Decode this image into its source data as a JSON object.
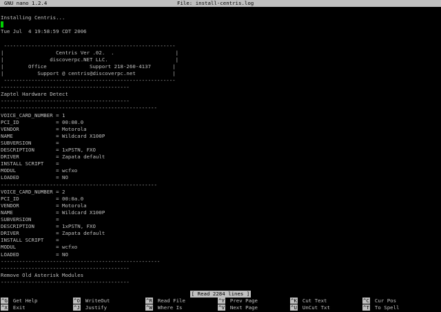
{
  "titlebar": {
    "version": "GNU nano 1.2.4",
    "file": "File: install-centris.log"
  },
  "editor": {
    "lines": [
      "",
      "Installing Centris...",
      "",
      "Tue Jul  4 19:58:59 CDT 2006",
      "",
      " --------------------------------------------------------",
      "|                 Centris Ver .02.  .                    |",
      "|               discoverpc.NET LLC.                      |",
      "|        Office              Support 218-260-4137       |",
      "|           Support @ centris@discoverpc.net            |",
      " --------------------------------------------------------",
      "------------------------------------------",
      "Zaptel Hardware Detect",
      "------------------------------------------",
      "---------------------------------------------------",
      "VOICE_CARD_NUMBER = 1",
      "PCI_ID            = 00:08.0",
      "VENDOR            = Motorola",
      "NAME              = Wildcard X100P",
      "SUBVERSION        =",
      "DESCRIPTION       = 1xPSTN, FXO",
      "DRIVER            = Zapata default",
      "INSTALL SCRIPT    =",
      "MODUL             = wcfxo",
      "LOADED            = NO",
      "---------------------------------------------------",
      "VOICE_CARD_NUMBER = 2",
      "PCI_ID            = 00:0a.0",
      "VENDOR            = Motorola",
      "NAME              = Wildcard X100P",
      "SUBVERSION        =",
      "DESCRIPTION       = 1xPSTN, FXO",
      "DRIVER            = Zapata default",
      "INSTALL SCRIPT    =",
      "MODUL             = wcfxo",
      "LOADED            = NO",
      "----------------------------------------------------",
      "------------------------------------------",
      "Remove Old Asterisk Modules",
      "------------------------------------------"
    ]
  },
  "status": "[ Read 2284 lines ]",
  "shortcuts": [
    {
      "key": "^G",
      "label": "Get Help"
    },
    {
      "key": "^X",
      "label": "Exit"
    },
    {
      "key": "^O",
      "label": "WriteOut"
    },
    {
      "key": "^J",
      "label": "Justify"
    },
    {
      "key": "^R",
      "label": "Read File"
    },
    {
      "key": "^W",
      "label": "Where Is"
    },
    {
      "key": "^Y",
      "label": "Prev Page"
    },
    {
      "key": "^V",
      "label": "Next Page"
    },
    {
      "key": "^K",
      "label": "Cut Text"
    },
    {
      "key": "^U",
      "label": "UnCut Txt"
    },
    {
      "key": "^C",
      "label": "Cur Pos"
    },
    {
      "key": "^T",
      "label": "To Spell"
    }
  ]
}
